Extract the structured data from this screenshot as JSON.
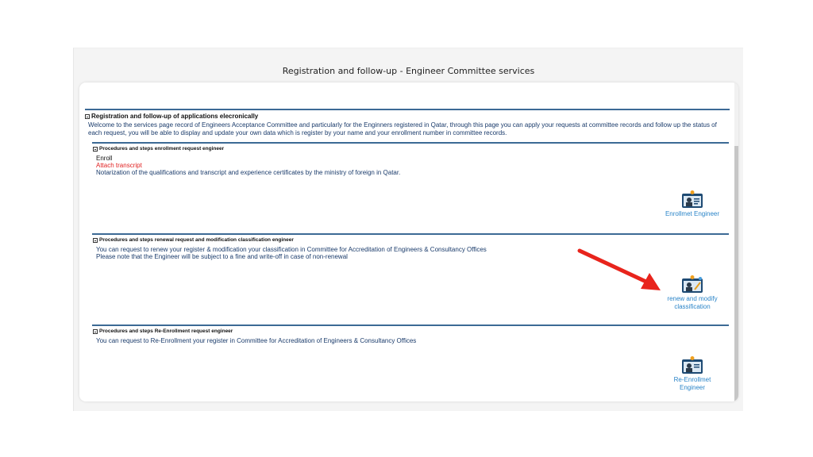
{
  "page": {
    "title": "Registration and follow-up - Engineer Committee services"
  },
  "main_section": {
    "heading": "Registration and follow-up of applications elecronically",
    "intro": "Welcome to the services page record of Engineers Acceptance Committee and particularly for the Enginners registered in Qatar, through this page you can apply your requests at committee records and follow up the status of each request, you will be able to display and update your own data which is register by your name and your enrollment number in committee records."
  },
  "sections": [
    {
      "heading": "Procedures and steps enrollment request engineer",
      "line1": "Enroll",
      "line2": "Attach transcript",
      "line3": "Notarization of the qualifications and transcript and experience certificates by the ministry of foreign in Qatar.",
      "action_label": "Enrollmet Engineer"
    },
    {
      "heading": "Procedures and steps renewal request and modification classification engineer",
      "line1": "You can request to renew your register & modification your classification in Committee for Accreditation of Engineers & Consultancy Offices",
      "line2": "Please note that the Engineer will be subject to a fine and write-off in case of non-renewal",
      "action_label_1": "renew and modify",
      "action_label_2": "classification"
    },
    {
      "heading": "Procedures and steps Re-Enrollment request engineer",
      "line1": "You can request to Re-Enrollment your register in Committee for Accreditation of Engineers & Consultancy Offices",
      "action_label_1": "Re-Enrollmet",
      "action_label_2": "Engineer"
    }
  ],
  "colors": {
    "section_border": "#3c6a95",
    "link": "#2a84c8",
    "alert_text": "#e02020",
    "annotation_arrow": "#e8241c"
  },
  "icons": [
    "collapse-toggle-icon",
    "engineer-id-card-icon",
    "annotation-arrow"
  ]
}
